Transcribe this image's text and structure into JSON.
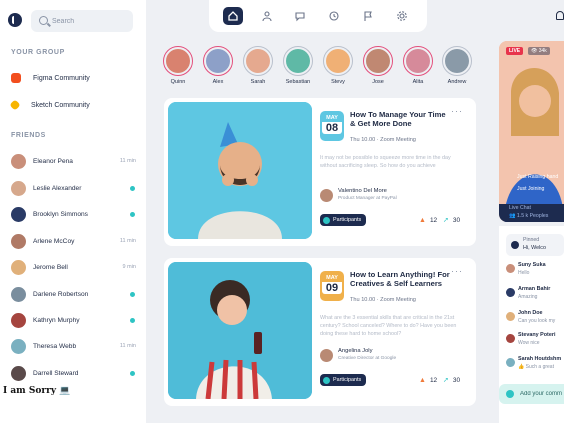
{
  "search": {
    "placeholder": "Search"
  },
  "sections": {
    "group": "YOUR GROUP",
    "friends": "FRIENDS"
  },
  "groups": [
    {
      "label": "Figma Community",
      "color": "#f24e1e"
    },
    {
      "label": "Sketch Community",
      "color": "#f7b500"
    }
  ],
  "friends": [
    {
      "name": "Eleanor Pena",
      "time": "11 min",
      "online": false,
      "color": "#c98f7a"
    },
    {
      "name": "Leslie Alexander",
      "time": "",
      "online": true,
      "color": "#d6a88c"
    },
    {
      "name": "Brooklyn Simmons",
      "time": "",
      "online": true,
      "color": "#2a3b66"
    },
    {
      "name": "Arlene McCoy",
      "time": "11 min",
      "online": false,
      "color": "#b07a66"
    },
    {
      "name": "Jerome Bell",
      "time": "9 min",
      "online": false,
      "color": "#e0b07a"
    },
    {
      "name": "Darlene Robertson",
      "time": "",
      "online": true,
      "color": "#7a8e9e"
    },
    {
      "name": "Kathryn Murphy",
      "time": "",
      "online": true,
      "color": "#a5453f"
    },
    {
      "name": "Theresa Webb",
      "time": "11 min",
      "online": false,
      "color": "#7ab0c0"
    },
    {
      "name": "Darrell Steward",
      "time": "",
      "online": true,
      "color": "#5a4a4a"
    }
  ],
  "overlay_text": "I am Sorry 💻",
  "nav": [
    {
      "icon": "home-icon",
      "active": true
    },
    {
      "icon": "people-icon",
      "active": false
    },
    {
      "icon": "chat-icon",
      "active": false
    },
    {
      "icon": "clock-icon",
      "active": false
    },
    {
      "icon": "flag-icon",
      "active": false
    },
    {
      "icon": "settings-icon",
      "active": false
    }
  ],
  "stories": [
    {
      "name": "Quinn",
      "color": "#d9826f",
      "muted": false
    },
    {
      "name": "Alex",
      "color": "#8da0c8",
      "muted": false
    },
    {
      "name": "Sarah",
      "color": "#e5a98f",
      "muted": true
    },
    {
      "name": "Sebastian",
      "color": "#5fb9a6",
      "muted": true
    },
    {
      "name": "Stevy",
      "color": "#f0b075",
      "muted": true
    },
    {
      "name": "Jose",
      "color": "#c08872",
      "muted": false
    },
    {
      "name": "Alita",
      "color": "#d68a9a",
      "muted": false
    },
    {
      "name": "Andrew",
      "color": "#8a9aa8",
      "muted": true
    }
  ],
  "posts": [
    {
      "month": "MAY",
      "day": "08",
      "date_color": "#5ec7e2",
      "title": "How To Manage Your Time & Get More Done",
      "meta": "Thu 10.00  ·  Zoom Meeting",
      "desc": "It may not be possible to squeeze more time in the day without sacrificing sleep. So how do you achieve",
      "author_name": "Valentino Del More",
      "author_role": "Product Manager  at  PayPal",
      "participants": "Participants",
      "likes": "12",
      "shares": "30",
      "image_bg": "#5ec7e2"
    },
    {
      "month": "MAY",
      "day": "09",
      "date_color": "#f0b04a",
      "title": "How to Learn Anything! For Creatives & Self Learners",
      "meta": "Thu 10.00  ·  Zoom Meeting",
      "desc": "What are the 3 essential skills that are critical in the 21st century? School canceled? Where to do? Have you been doing these hard to home school?",
      "author_name": "Angelina Joly",
      "author_role": "Creative Director  at  Google",
      "participants": "Participants",
      "likes": "12",
      "shares": "30",
      "image_bg": "#4fbcd8"
    }
  ],
  "live": {
    "badge": "LIVE",
    "views": "👁 34k",
    "chat1": "Just Raising hand",
    "chat2": "Just Joining",
    "chat_label": "Live Chat",
    "people": "👥 1.5 k Peoples"
  },
  "pinned": "Pinned",
  "pinned_sub": "Hi, Welco",
  "comments": [
    {
      "name": "Suny Suka",
      "text": "Hello",
      "color": "#c98f7a"
    },
    {
      "name": "Arman Bahir",
      "text": "Amazing",
      "color": "#2a3b66"
    },
    {
      "name": "John Doe",
      "text": "Can you look my",
      "color": "#e0b07a"
    },
    {
      "name": "Stevany Poteri",
      "text": "Wow nice",
      "color": "#a5453f"
    },
    {
      "name": "Sarah Houtdshm",
      "text": "👍 Such a great",
      "color": "#7ab0c0"
    }
  ],
  "comment_input": {
    "placeholder": "Add your comm"
  }
}
